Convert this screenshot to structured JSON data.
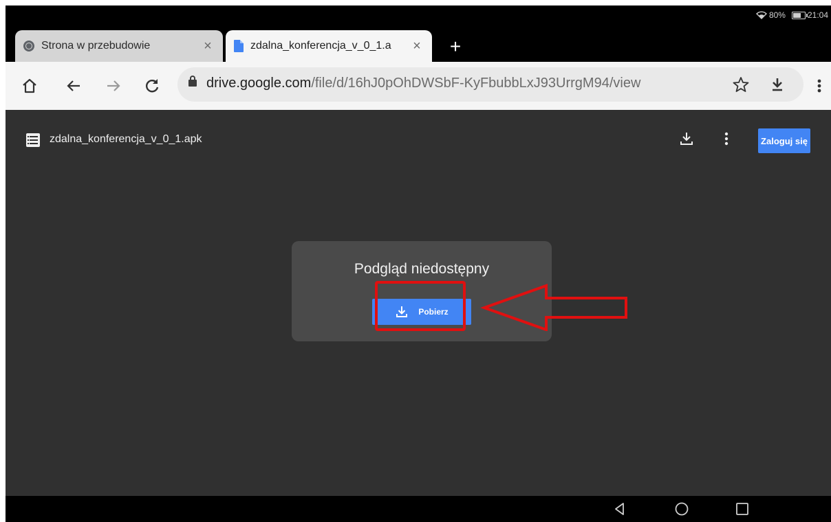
{
  "status_bar": {
    "battery": "80%",
    "time": "21:04"
  },
  "tabs": [
    {
      "title": "Strona w przebudowie",
      "icon": "globe-icon",
      "active": false
    },
    {
      "title": "zdalna_konferencja_v_0_1.a",
      "icon": "document-icon",
      "active": true
    }
  ],
  "toolbar": {
    "url_host": "drive.google.com",
    "url_path": "/file/d/16hJ0pOhDWSbF-KyFbubbLxJ93UrrgM94/view"
  },
  "file_viewer": {
    "file_name": "zdalna_konferencja_v_0_1.apk",
    "login_label": "Zaloguj się",
    "preview_message": "Podgląd niedostępny",
    "download_label": "Pobierz"
  },
  "colors": {
    "accent": "#4285f4",
    "annotation": "#e01010",
    "viewer_bg": "#303030",
    "card_bg": "#4a4a4a"
  }
}
